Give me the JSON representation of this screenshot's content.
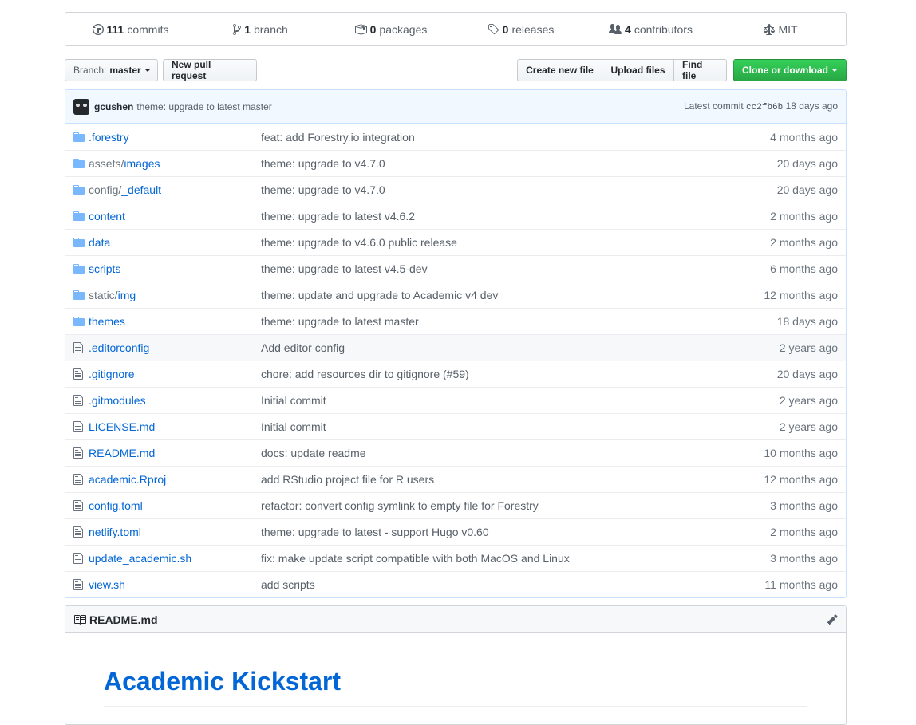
{
  "summary": {
    "commits": {
      "count": "111",
      "label": "commits",
      "icon": "history-icon"
    },
    "branches": {
      "count": "1",
      "label": "branch",
      "icon": "git-branch-icon"
    },
    "packages": {
      "count": "0",
      "label": "packages",
      "icon": "package-icon"
    },
    "releases": {
      "count": "0",
      "label": "releases",
      "icon": "tag-icon"
    },
    "contributors": {
      "count": "4",
      "label": "contributors",
      "icon": "people-icon"
    },
    "license": {
      "label": "MIT",
      "icon": "law-icon"
    }
  },
  "toolbar": {
    "branch_label": "Branch:",
    "branch_value": "master",
    "new_pr": "New pull request",
    "create_file": "Create new file",
    "upload_files": "Upload files",
    "find_file": "Find file",
    "clone": "Clone or download",
    "clone_color": "#28a745"
  },
  "commit": {
    "author": "gcushen",
    "message": "theme: upgrade to latest master",
    "latest_label": "Latest commit",
    "sha": "cc2fb6b",
    "age": "18 days ago"
  },
  "files": [
    {
      "type": "dir",
      "prefix": "",
      "name": ".forestry",
      "message": "feat: add Forestry.io integration",
      "age": "4 months ago"
    },
    {
      "type": "dir",
      "prefix": "assets/",
      "name": "images",
      "message": "theme: upgrade to v4.7.0",
      "age": "20 days ago"
    },
    {
      "type": "dir",
      "prefix": "config/",
      "name": "_default",
      "message": "theme: upgrade to v4.7.0",
      "age": "20 days ago"
    },
    {
      "type": "dir",
      "prefix": "",
      "name": "content",
      "message": "theme: upgrade to latest v4.6.2",
      "age": "2 months ago"
    },
    {
      "type": "dir",
      "prefix": "",
      "name": "data",
      "message": "theme: upgrade to v4.6.0 public release",
      "age": "2 months ago"
    },
    {
      "type": "dir",
      "prefix": "",
      "name": "scripts",
      "message": "theme: upgrade to latest v4.5-dev",
      "age": "6 months ago"
    },
    {
      "type": "dir",
      "prefix": "static/",
      "name": "img",
      "message": "theme: update and upgrade to Academic v4 dev",
      "age": "12 months ago"
    },
    {
      "type": "dir",
      "prefix": "",
      "name": "themes",
      "message": "theme: upgrade to latest master",
      "age": "18 days ago"
    },
    {
      "type": "file",
      "prefix": "",
      "name": ".editorconfig",
      "message": "Add editor config",
      "age": "2 years ago"
    },
    {
      "type": "file",
      "prefix": "",
      "name": ".gitignore",
      "message": "chore: add resources dir to gitignore (#59)",
      "age": "20 days ago"
    },
    {
      "type": "file",
      "prefix": "",
      "name": ".gitmodules",
      "message": "Initial commit",
      "age": "2 years ago"
    },
    {
      "type": "file",
      "prefix": "",
      "name": "LICENSE.md",
      "message": "Initial commit",
      "age": "2 years ago"
    },
    {
      "type": "file",
      "prefix": "",
      "name": "README.md",
      "message": "docs: update readme",
      "age": "10 months ago"
    },
    {
      "type": "file",
      "prefix": "",
      "name": "academic.Rproj",
      "message": "add RStudio project file for R users",
      "age": "12 months ago"
    },
    {
      "type": "file",
      "prefix": "",
      "name": "config.toml",
      "message": "refactor: convert config symlink to empty file for Forestry",
      "age": "3 months ago"
    },
    {
      "type": "file",
      "prefix": "",
      "name": "netlify.toml",
      "message": "theme: upgrade to latest - support Hugo v0.60",
      "age": "2 months ago"
    },
    {
      "type": "file",
      "prefix": "",
      "name": "update_academic.sh",
      "message": "fix: make update script compatible with both MacOS and Linux",
      "age": "3 months ago"
    },
    {
      "type": "file",
      "prefix": "",
      "name": "view.sh",
      "message": "add scripts",
      "age": "11 months ago"
    }
  ],
  "highlighted_row": ".editorconfig",
  "readme": {
    "filename": "README.md",
    "heading": "Academic Kickstart"
  },
  "colors": {
    "link": "#0366d6",
    "folder": "#79b8ff"
  }
}
